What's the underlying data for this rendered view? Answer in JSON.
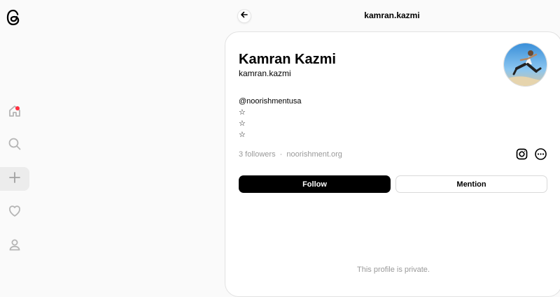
{
  "header": {
    "title": "kamran.kazmi"
  },
  "nav": {
    "items": [
      {
        "name": "home",
        "has_notification": true
      },
      {
        "name": "search"
      },
      {
        "name": "create"
      },
      {
        "name": "activity"
      },
      {
        "name": "profile"
      }
    ]
  },
  "profile": {
    "display_name": "Kamran Kazmi",
    "username": "kamran.kazmi",
    "bio_lines": [
      "@noorishmentusa",
      "☆",
      "☆",
      "☆"
    ],
    "followers_text": "3 followers",
    "separator": "·",
    "link_text": "noorishment.org",
    "follow_label": "Follow",
    "mention_label": "Mention",
    "private_text": "This profile is private."
  },
  "colors": {
    "notification": "#ff3040",
    "primary_button": "#000000"
  }
}
